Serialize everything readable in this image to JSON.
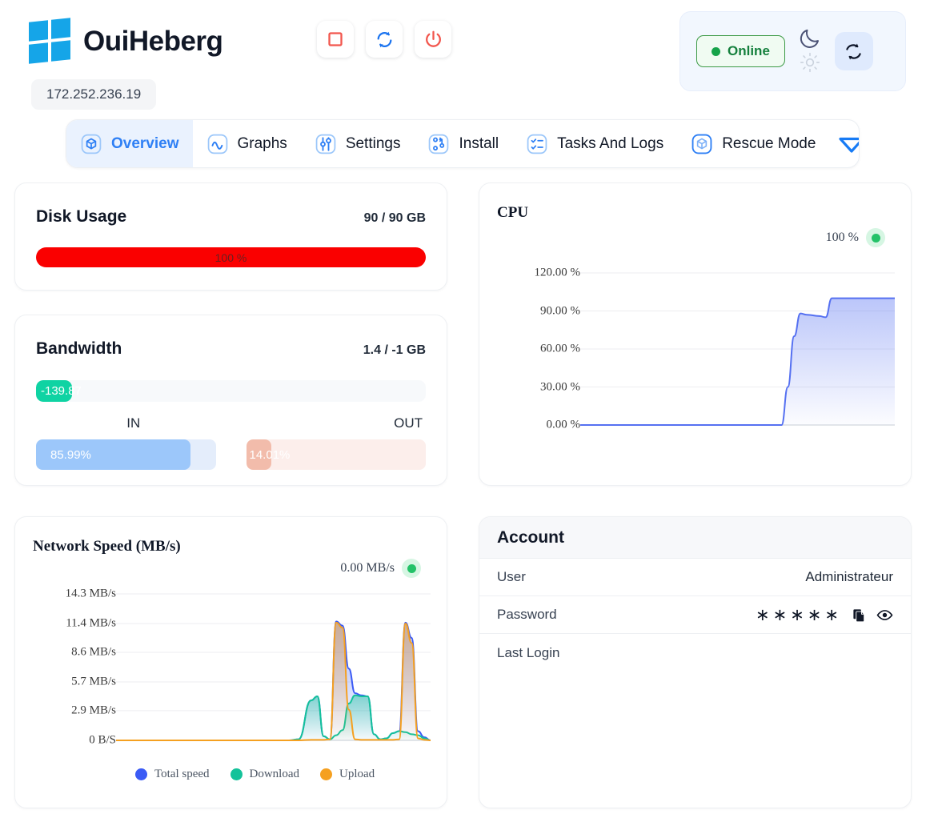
{
  "header": {
    "brand_name": "OuiHeberg",
    "ip_address": "172.252.236.19",
    "controls": [
      {
        "name": "stop-button",
        "icon": "square-stop-icon"
      },
      {
        "name": "restart-button",
        "icon": "refresh-circular-icon"
      },
      {
        "name": "power-button",
        "icon": "power-icon"
      }
    ],
    "status": {
      "online_label": "Online",
      "online_color": "#15803d",
      "theme_moon_icon": "moon-icon",
      "theme_sun_icon": "sun-icon",
      "sync_icon": "sync-arrows-icon"
    }
  },
  "tabs": [
    {
      "label": "Overview",
      "icon": "cube-icon",
      "active": true
    },
    {
      "label": "Graphs",
      "icon": "wave-chart-icon",
      "active": false
    },
    {
      "label": "Settings",
      "icon": "sliders-icon",
      "active": false
    },
    {
      "label": "Install",
      "icon": "git-branch-icon",
      "active": false
    },
    {
      "label": "Tasks And Logs",
      "icon": "checklist-icon",
      "active": false
    },
    {
      "label": "Rescue Mode",
      "icon": "cube-icon",
      "active": false
    }
  ],
  "tab_more_icon": "chevron-down-icon",
  "disk": {
    "title": "Disk Usage",
    "value": "90 / 90 GB",
    "percent_label": "100 %",
    "percent": 100,
    "bar_color": "#fa0000"
  },
  "bandwidth": {
    "title": "Bandwidth",
    "value": "1.4 / -1 GB",
    "indicator_label": "-139.87",
    "indicator_color": "#0fd3a3",
    "in_label": "IN",
    "out_label": "OUT",
    "in_percent_label": "85.99%",
    "out_percent_label": "14.01%",
    "in_percent": 85.99,
    "out_percent": 14.01,
    "in_color": "#9cc7fa",
    "out_color": "#f2bcab"
  },
  "account": {
    "title": "Account",
    "rows": [
      {
        "key": "User",
        "value": "Administrateur"
      },
      {
        "key": "Password",
        "value": "∗∗∗∗∗"
      },
      {
        "key": "Last Login",
        "value": ""
      }
    ],
    "copy_icon": "copy-icon",
    "eye_icon": "eye-icon"
  },
  "chart_data": [
    {
      "type": "area",
      "title": "CPU",
      "current_value": "100 %",
      "ylabel": "",
      "xlabel": "",
      "ylim": [
        0,
        120
      ],
      "yticks": [
        0,
        30,
        60,
        90,
        120
      ],
      "ytick_labels": [
        "0.00 %",
        "30.00 %",
        "60.00 %",
        "90.00 %",
        "120.00 %"
      ],
      "grid": true,
      "legend": "none",
      "series": [
        {
          "name": "CPU",
          "color": "#5570f1",
          "x": [
            0,
            10,
            20,
            30,
            40,
            50,
            60,
            62,
            64,
            66,
            68,
            70,
            72,
            76,
            78,
            80,
            84,
            88,
            92,
            96,
            100
          ],
          "values": [
            0,
            0,
            0,
            0,
            0,
            0,
            0,
            0,
            0,
            30,
            70,
            88,
            87,
            86,
            85,
            100,
            100,
            100,
            100,
            100,
            100
          ]
        }
      ]
    },
    {
      "type": "area",
      "title": "Network Speed (MB/s)",
      "current_value": "0.00 MB/s",
      "ylabel": "",
      "xlabel": "",
      "ylim": [
        0,
        14.3
      ],
      "yticks": [
        0,
        2.9,
        5.7,
        8.6,
        11.4,
        14.3
      ],
      "ytick_labels": [
        "0 B/S",
        "2.9 MB/s",
        "5.7 MB/s",
        "8.6 MB/s",
        "11.4 MB/s",
        "14.3 MB/s"
      ],
      "grid": true,
      "legend": "bottom",
      "legend_entries": [
        {
          "label": "Total speed",
          "color": "#3b5bf5"
        },
        {
          "label": "Download",
          "color": "#14c29a"
        },
        {
          "label": "Upload",
          "color": "#f5a020"
        }
      ],
      "series": [
        {
          "name": "Total speed",
          "color": "#3b5bf5",
          "x": [
            0,
            55,
            58,
            62,
            64,
            66,
            68,
            70,
            72,
            74,
            76,
            78,
            80,
            82,
            84,
            86,
            88,
            90,
            92,
            94,
            96,
            98,
            100
          ],
          "values": [
            0,
            0,
            0.1,
            3.9,
            4.3,
            0.4,
            0.1,
            11.6,
            11.2,
            7.0,
            4.6,
            4.4,
            4.3,
            0.6,
            0.1,
            0.2,
            0.7,
            0.9,
            11.5,
            10.0,
            0.9,
            0.3,
            0
          ]
        },
        {
          "name": "Download",
          "color": "#14c29a",
          "x": [
            0,
            55,
            58,
            62,
            64,
            66,
            68,
            70,
            72,
            74,
            76,
            78,
            80,
            82,
            84,
            86,
            88,
            90,
            92,
            94,
            96,
            98,
            100
          ],
          "values": [
            0,
            0,
            0.1,
            3.9,
            4.3,
            0.4,
            0.1,
            0.5,
            1.0,
            3.6,
            4.4,
            4.3,
            4.3,
            0.6,
            0.1,
            0.2,
            0.7,
            0.9,
            0.8,
            0.6,
            0.5,
            0.2,
            0
          ]
        },
        {
          "name": "Upload",
          "color": "#f5a020",
          "x": [
            0,
            55,
            58,
            62,
            64,
            66,
            68,
            70,
            72,
            74,
            76,
            78,
            80,
            82,
            84,
            86,
            88,
            90,
            92,
            94,
            96,
            98,
            100
          ],
          "values": [
            0,
            0,
            0,
            0.05,
            0.05,
            0.05,
            0.1,
            11.5,
            11.0,
            3.0,
            0.1,
            0.05,
            0.05,
            0.05,
            0.05,
            0.05,
            0.05,
            0.1,
            11.4,
            9.5,
            0.2,
            0.05,
            0
          ]
        }
      ]
    }
  ]
}
